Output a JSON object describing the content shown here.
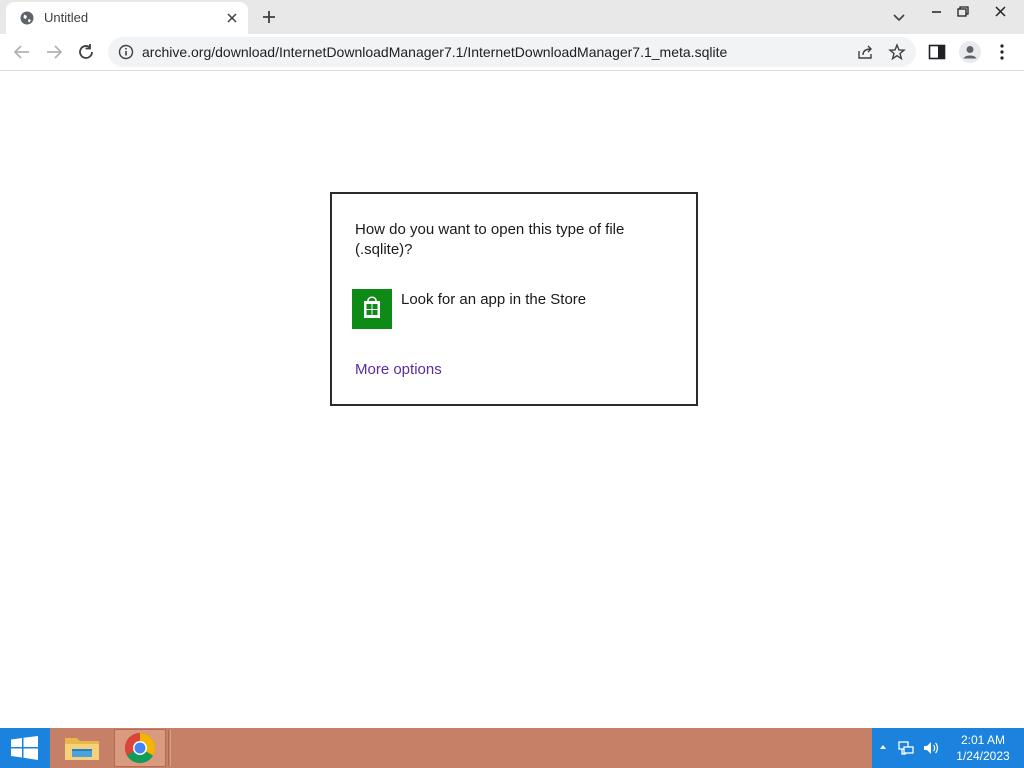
{
  "browser": {
    "tab": {
      "title": "Untitled",
      "favicon": "globe-icon"
    },
    "new_tab_icon": "plus-icon",
    "address_bar": {
      "url": "archive.org/download/InternetDownloadManager7.1/InternetDownloadManager7.1_meta.sqlite",
      "security_icon": "info-icon"
    }
  },
  "dialog": {
    "question": "How do you want to open this type of file (.sqlite)?",
    "options": [
      {
        "label": "Look for an app in the Store",
        "icon": "store-icon"
      }
    ],
    "more_options_label": "More options",
    "link_color": "#5a2ca0",
    "store_tile_color": "#0e8a16"
  },
  "taskbar": {
    "color": "#c58067",
    "start_color": "#1b83de",
    "pinned_apps": [
      {
        "name": "File Explorer",
        "icon": "folder-icon"
      },
      {
        "name": "Google Chrome",
        "icon": "chrome-icon",
        "active": true
      }
    ],
    "clock": {
      "time": "2:01 AM",
      "date": "1/24/2023"
    }
  }
}
